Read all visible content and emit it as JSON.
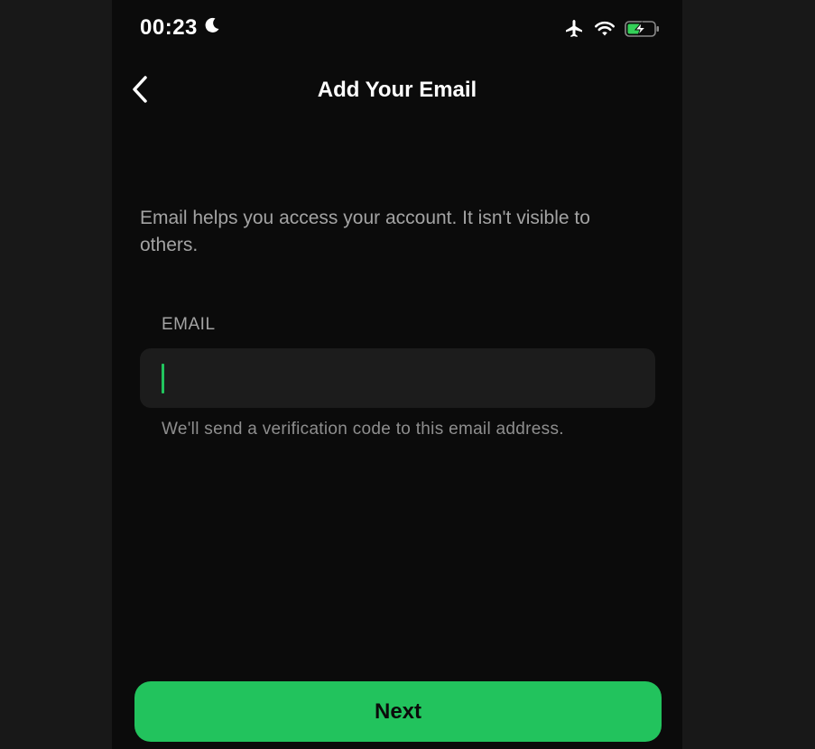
{
  "status_bar": {
    "time": "00:23",
    "icons": [
      "moon-icon",
      "airplane-icon",
      "wifi-icon",
      "battery-charging-icon"
    ]
  },
  "nav": {
    "title": "Add Your Email",
    "back_icon": "chevron-left-icon"
  },
  "content": {
    "description": "Email helps you access your account. It isn't visible to others.",
    "email_label": "EMAIL",
    "email_value": "",
    "helper_text": "We'll send a verification code to this email address."
  },
  "actions": {
    "next_label": "Next"
  },
  "colors": {
    "background": "#0b0b0b",
    "accent": "#22c35d",
    "input_bg": "#1c1c1c",
    "secondary_text": "#a3a3a3"
  }
}
